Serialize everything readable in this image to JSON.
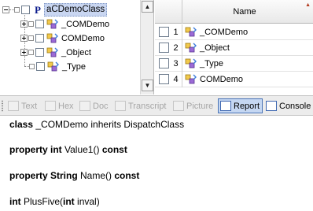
{
  "tree": {
    "root": {
      "badge": "P",
      "label": "aCDemoClass"
    },
    "children": [
      {
        "label": "_COMDemo",
        "expandable": true
      },
      {
        "label": "COMDemo",
        "expandable": true
      },
      {
        "label": "_Object",
        "expandable": true
      },
      {
        "label": "_Type",
        "expandable": false
      }
    ]
  },
  "grid": {
    "header": "Name",
    "rows": [
      {
        "num": "1",
        "name": "_COMDemo"
      },
      {
        "num": "2",
        "name": "_Object"
      },
      {
        "num": "3",
        "name": "_Type"
      },
      {
        "num": "4",
        "name": "COMDemo"
      }
    ]
  },
  "tabs": [
    {
      "label": "Text",
      "enabled": false,
      "icon": "text-icon"
    },
    {
      "label": "Hex",
      "enabled": false,
      "icon": "hex-icon"
    },
    {
      "label": "Doc",
      "enabled": false,
      "icon": "doc-icon"
    },
    {
      "label": "Transcript",
      "enabled": false,
      "icon": "transcript-icon"
    },
    {
      "label": "Picture",
      "enabled": false,
      "icon": "picture-icon"
    },
    {
      "label": "Report",
      "enabled": true,
      "active": true,
      "icon": "report-icon"
    },
    {
      "label": "Console",
      "enabled": true,
      "icon": "console-icon"
    }
  ],
  "report": {
    "line1": {
      "keyword": "class",
      "rest": " _COMDemo inherits DispatchClass"
    },
    "line2": {
      "keyword": "property int",
      "name": " Value1() ",
      "suffix": "const"
    },
    "line3": {
      "keyword": "property String",
      "name": " Name() ",
      "suffix": "const"
    },
    "line4": {
      "keyword": "int",
      "name": " PlusFive(",
      "arg_type": "int",
      "arg": " inval)"
    }
  },
  "colors": {
    "selection": "#c9d6f1",
    "active_tab": "#c5d7f2",
    "badge": "#0a1a8c"
  }
}
